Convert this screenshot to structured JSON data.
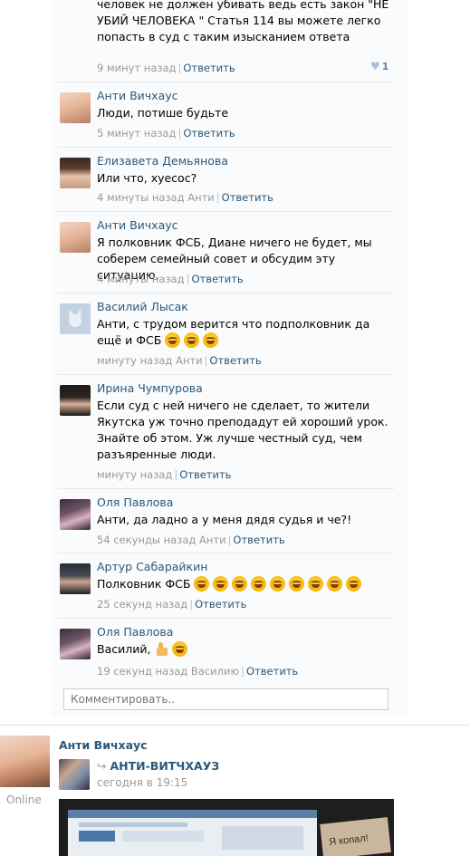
{
  "first_comment": {
    "text": "человек не должен убивать ведь есть закон \"НЕ УБИЙ ЧЕЛОВЕКА \" Статья 114 вы можете легко попасть в суд с таким изысканием ответа",
    "time": "9 минут назад",
    "reply_label": "Ответить",
    "likes": "1"
  },
  "comments": [
    {
      "author": "Анти Вичхаус",
      "text": "Люди, потише будьте",
      "time": "5 минут назад",
      "to": "",
      "reply_label": "Ответить"
    },
    {
      "author": "Елизавета Демьянова",
      "text": "Или что, хуесос?",
      "time": "4 минуты назад",
      "to": "Анти",
      "reply_label": "Ответить"
    },
    {
      "author": "Анти Вичхаус",
      "text": "Я полковник ФСБ, Диане ничего не будет, мы соберем семейный совет и обсудим эту ситуацию.",
      "time": "4 минуты назад",
      "to": "",
      "reply_label": "Ответить"
    },
    {
      "author": "Василий Лысак",
      "text": "Анти, с трудом верится что подполковник да ещё и ФСБ",
      "time": "минуту назад",
      "to": "Анти",
      "reply_label": "Ответить",
      "emoji_count": 3
    },
    {
      "author": "Ирина Чумпурова",
      "text": "Если суд с ней ничего не сделает, то жители Якутска уж точно преподадут ей хороший урок. Знайте об этом. Уж лучше честный суд, чем разъяренные люди.",
      "time": "минуту назад",
      "to": "",
      "reply_label": "Ответить"
    },
    {
      "author": "Оля Павлова",
      "text": "Анти, да ладно а у меня дядя судья и че?!",
      "time": "54 секунды назад",
      "to": "Анти",
      "reply_label": "Ответить"
    },
    {
      "author": "Артур Сабарайкин",
      "text": "Полковник ФСБ",
      "time": "25 секунд назад",
      "to": "",
      "reply_label": "Ответить",
      "emoji_count": 9
    },
    {
      "author": "Оля Павлова",
      "text": "Василий,",
      "time": "19 секунд назад",
      "to": "Василию",
      "reply_label": "Ответить",
      "emoji_count": 1,
      "thumb": true
    }
  ],
  "comment_input": {
    "placeholder": "Комментировать.."
  },
  "post": {
    "author": "Анти Вичхаус",
    "status": "Online",
    "repost_name": "АНТИ-ВИТЧХАУЗ",
    "repost_time": "сегодня в 19:15",
    "image_caption": "Я копал!"
  },
  "colors": {
    "link": "#2b587a",
    "meta": "#999999",
    "divider": "#e5e9ed",
    "card_bg": "#fafbfc"
  },
  "icons": {
    "like": "heart-icon",
    "repost": "repost-arrow-icon",
    "laugh": "face-with-tears-of-joy-emoji",
    "thumb": "thumbs-up-emoji"
  }
}
